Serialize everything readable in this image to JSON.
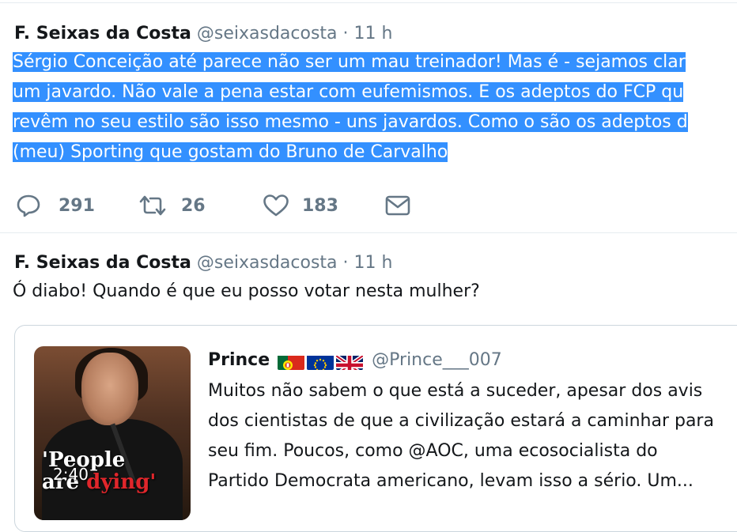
{
  "colors": {
    "accent": "#3390ff",
    "secondary_text": "#657786",
    "border": "#e6ecf0"
  },
  "tweets": [
    {
      "display_name": "F. Seixas da Costa",
      "handle": "@seixasdacosta",
      "separator": "·",
      "time": "11 h",
      "text_lines": [
        "Sérgio Conceição até parece não ser um mau treinador! Mas é - sejamos clar",
        "um javardo. Não vale a pena estar com eufemismos. E os adeptos do FCP qu",
        "revêm no seu estilo são isso mesmo - uns javardos. Como o são os adeptos d",
        "(meu) Sporting que gostam do Bruno de Carvalho"
      ],
      "text_selected": true,
      "actions": {
        "reply": {
          "icon": "reply-icon",
          "count": "291"
        },
        "retweet": {
          "icon": "retweet-icon",
          "count": "26"
        },
        "like": {
          "icon": "heart-icon",
          "count": "183"
        },
        "message": {
          "icon": "envelope-icon"
        }
      }
    },
    {
      "display_name": "F. Seixas da Costa",
      "handle": "@seixasdacosta",
      "separator": "·",
      "time": "11 h",
      "text_lines": [
        "Ó diabo! Quando é que eu posso votar nesta mulher?"
      ],
      "quoted": {
        "display_name": "Prince",
        "flags": [
          "portugal-flag-icon",
          "eu-flag-icon",
          "uk-flag-icon"
        ],
        "handle": "@Prince___007",
        "video_overlay": {
          "line1": "'People",
          "line2_prefix": "are ",
          "line2_red": "dying'"
        },
        "video_duration": "2:40",
        "text_lines": [
          "Muitos não sabem o que está a suceder, apesar dos avis",
          "dos cientistas de que a civilização estará a caminhar para",
          "seu fim. Poucos, como @AOC, uma ecosocialista do",
          "Partido Democrata americano, levam isso a sério. Um..."
        ]
      }
    }
  ]
}
